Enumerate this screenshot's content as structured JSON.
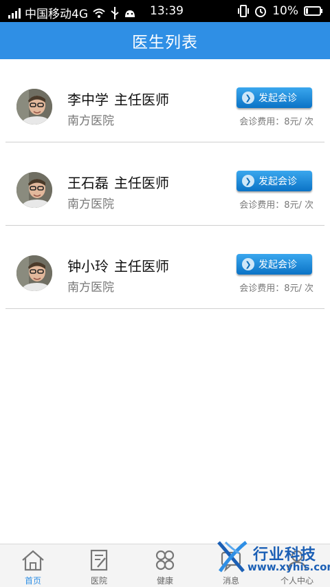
{
  "status_bar": {
    "carrier": "中国移动4G",
    "time": "13:39",
    "battery": "10%"
  },
  "header": {
    "title": "医生列表"
  },
  "doctors": [
    {
      "name": "李中学",
      "title": "主任医师",
      "hospital": "南方医院",
      "button": "发起会诊",
      "fee": "会诊费用：8元/ 次"
    },
    {
      "name": "王石磊",
      "title": "主任医师",
      "hospital": "南方医院",
      "button": "发起会诊",
      "fee": "会诊费用：8元/ 次"
    },
    {
      "name": "钟小玲",
      "title": "主任医师",
      "hospital": "南方医院",
      "button": "发起会诊",
      "fee": "会诊费用：8元/ 次"
    }
  ],
  "tabs": [
    {
      "label": "首页",
      "icon": "home-icon",
      "active": true
    },
    {
      "label": "医院",
      "icon": "hospital-icon",
      "active": false
    },
    {
      "label": "健康",
      "icon": "health-icon",
      "active": false
    },
    {
      "label": "消息",
      "icon": "message-icon",
      "active": false
    },
    {
      "label": "个人中心",
      "icon": "user-icon",
      "active": false
    }
  ],
  "watermark": {
    "brand": "行业科技",
    "url": "www.xyhis.com"
  },
  "colors": {
    "header_bg": "#2f8fe5",
    "button_top": "#3aa7ee",
    "button_bottom": "#0b73c6",
    "active_tab": "#2f8fe5"
  }
}
